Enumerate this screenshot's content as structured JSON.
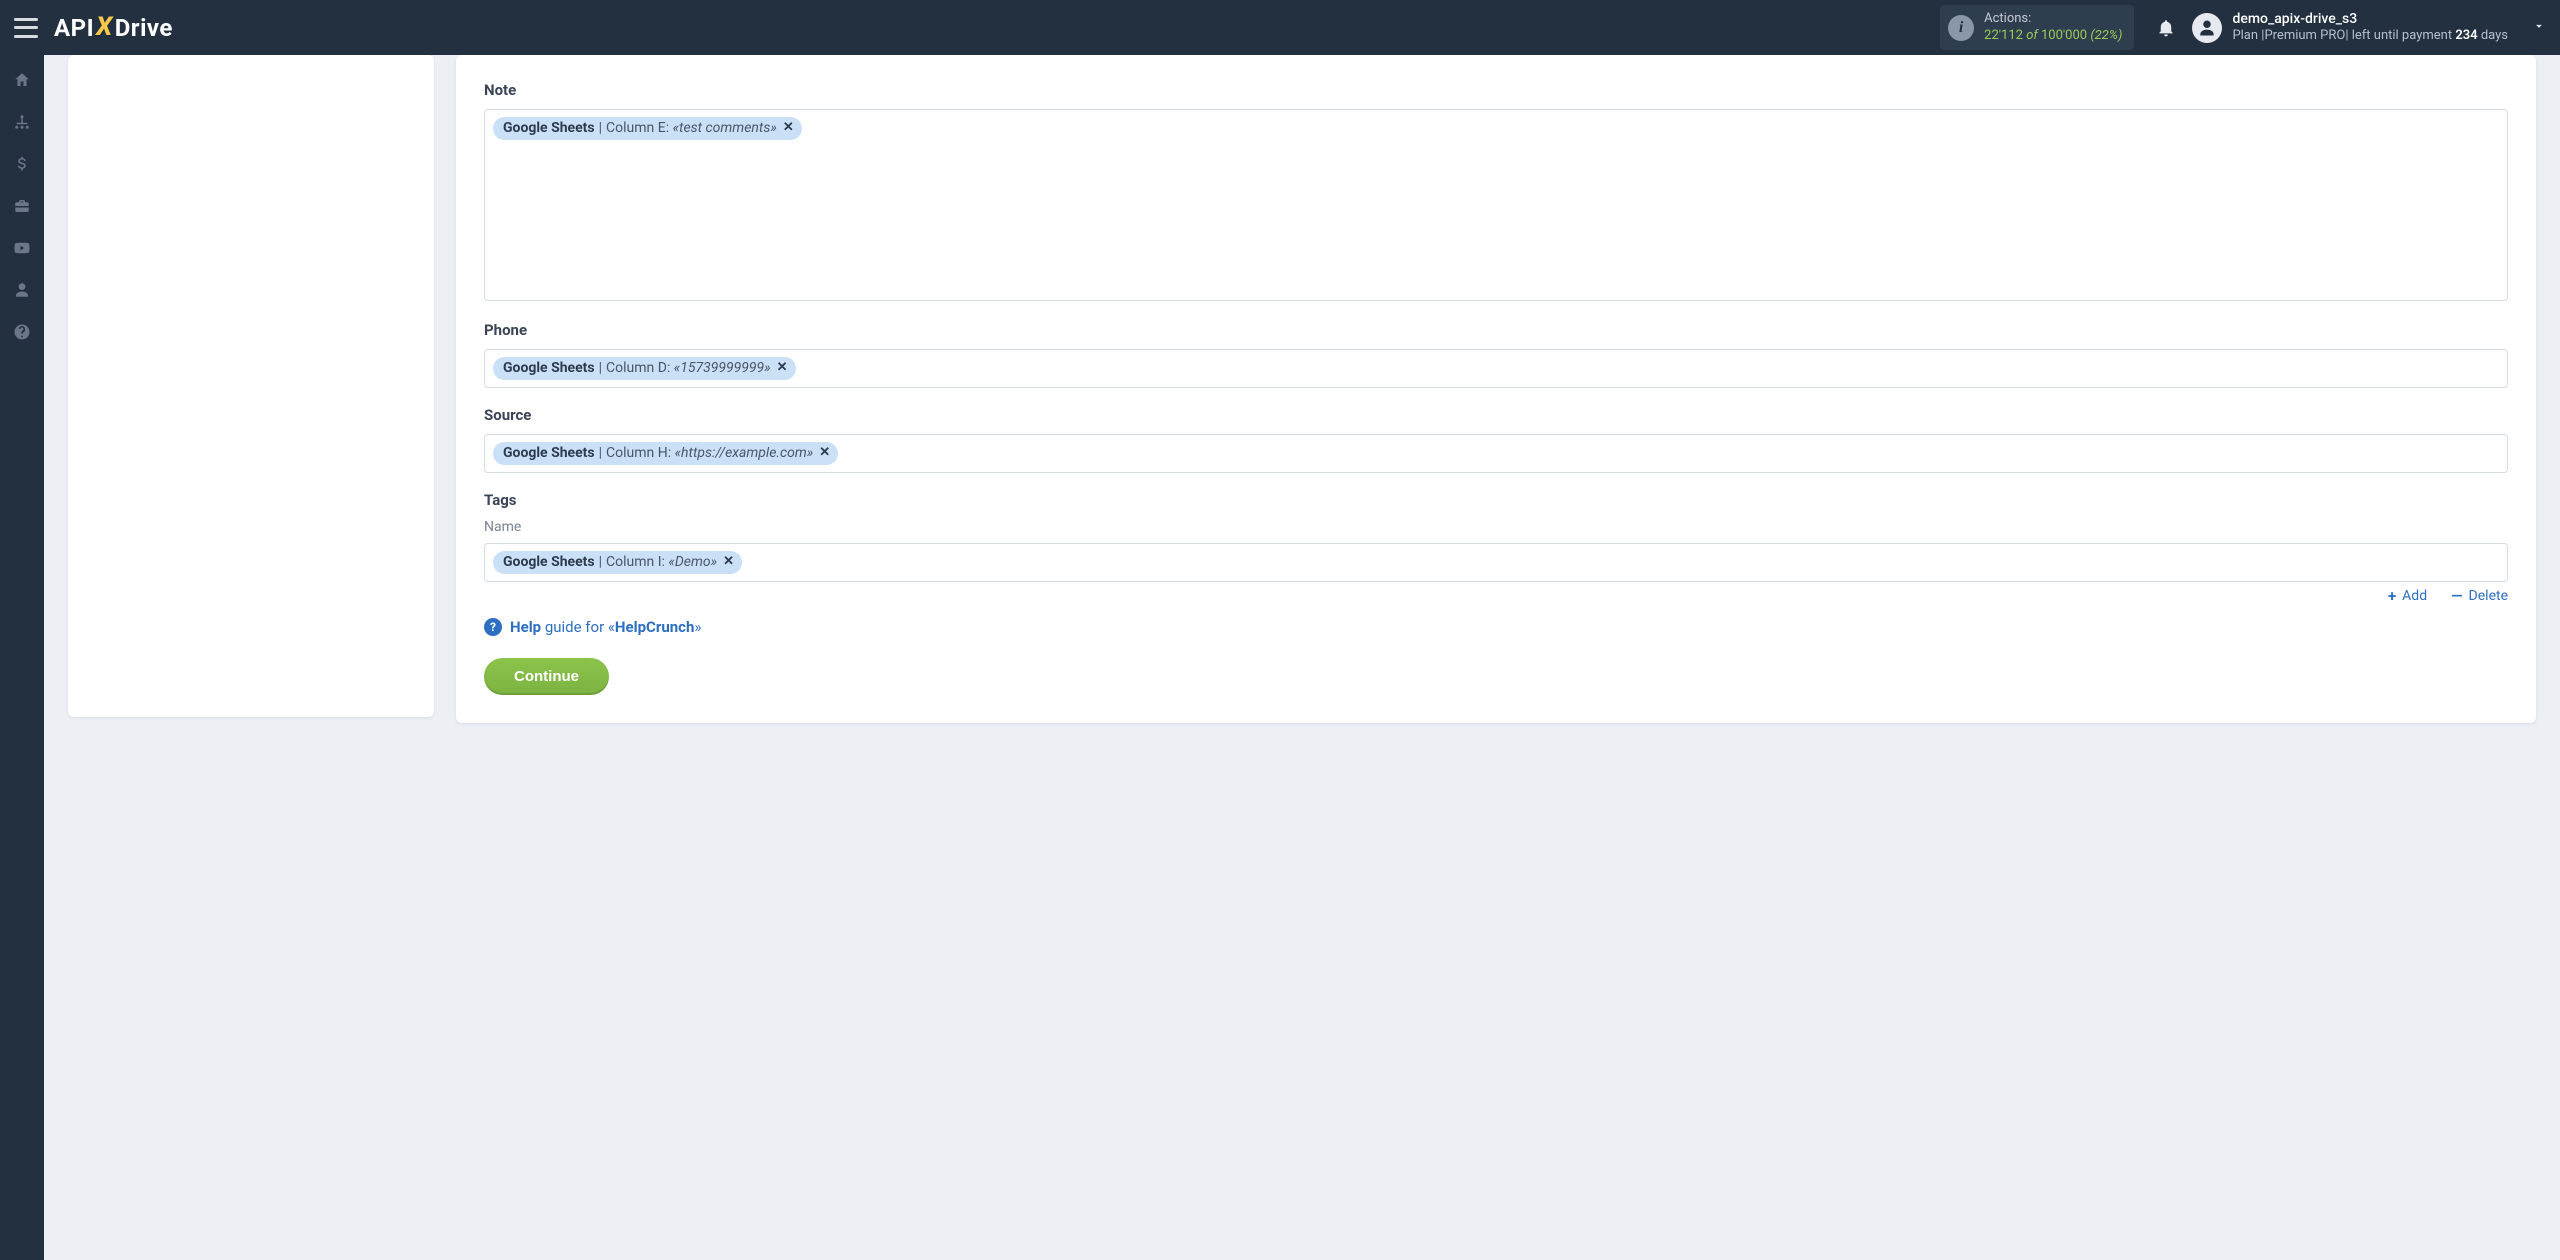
{
  "brand": {
    "part1": "API",
    "x": "X",
    "part2": "Drive"
  },
  "header": {
    "actions": {
      "label": "Actions:",
      "used": "22'112",
      "of_word": "of",
      "total": "100'000",
      "pct": "(22%)"
    },
    "user": {
      "name": "demo_apix-drive_s3",
      "plan_line_pre": "Plan |Premium PRO| left until payment ",
      "days_num": "234",
      "days_word": " days"
    }
  },
  "rail": {
    "home": "home-icon",
    "sitemap": "sitemap-icon",
    "billing": "dollar-icon",
    "briefcase": "briefcase-icon",
    "youtube": "youtube-icon",
    "account": "user-icon",
    "help": "help-icon"
  },
  "form": {
    "note": {
      "label": "Note",
      "chip": {
        "source": "Google Sheets",
        "col_label": "Column E:",
        "value": "«test comments»"
      }
    },
    "phone": {
      "label": "Phone",
      "chip": {
        "source": "Google Sheets",
        "col_label": "Column D:",
        "value": "«15739999999»"
      }
    },
    "source": {
      "label": "Source",
      "chip": {
        "source": "Google Sheets",
        "col_label": "Column H:",
        "value": "«https://example.com»"
      }
    },
    "tags": {
      "label": "Tags",
      "sublabel": "Name",
      "chip": {
        "source": "Google Sheets",
        "col_label": "Column I:",
        "value": "«Demo»"
      }
    },
    "add_label": "Add",
    "delete_label": "Delete",
    "help": {
      "help_word": "Help",
      "guide_for": " guide for «",
      "target": "HelpCrunch",
      "close": "»"
    },
    "continue_label": "Continue"
  }
}
